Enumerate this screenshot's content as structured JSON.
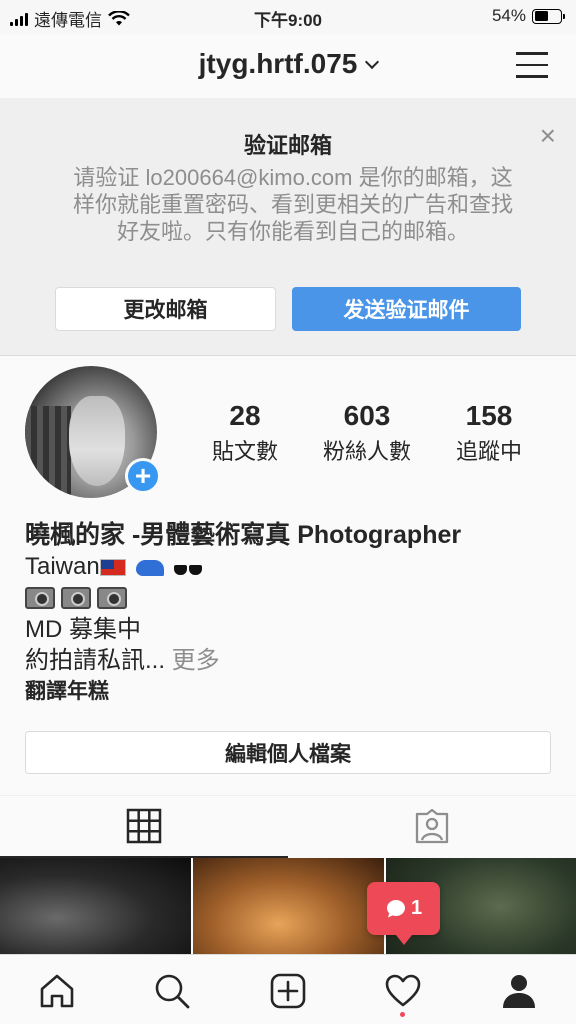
{
  "status_bar": {
    "carrier": "遠傳電信",
    "time": "下午9:00",
    "battery": "54%",
    "battery_level": 0.54
  },
  "header": {
    "username": "jtyg.hrtf.075",
    "icons": [
      "chevron-down-icon",
      "hamburger-menu-icon"
    ]
  },
  "verify_email": {
    "title": "验证邮箱",
    "body": "请验证 lo200664@kimo.com 是你的邮箱，这样你就能重置密码、看到更相关的广告和查找好友啦。只有你能看到自己的邮箱。",
    "change_button": "更改邮箱",
    "send_button": "发送验证邮件",
    "close_icon": "×"
  },
  "profile": {
    "stats": [
      {
        "value": "28",
        "label": "貼文數"
      },
      {
        "value": "603",
        "label": "粉絲人數"
      },
      {
        "value": "158",
        "label": "追蹤中"
      }
    ],
    "bio": {
      "name": "曉楓的家 -男體藝術寫真 Photographer",
      "line2": "Taiwan",
      "line4": "MD 募集中",
      "line5": "約拍請私訊...",
      "more": " 更多",
      "translate": "翻譯年糕"
    },
    "edit_button": "編輯個人檔案"
  },
  "tabs": [
    {
      "name": "grid",
      "icon": "grid-icon",
      "active": true
    },
    {
      "name": "tagged",
      "icon": "tagged-person-icon",
      "active": false
    }
  ],
  "notification": {
    "count": "1",
    "icon": "comment-icon"
  },
  "bottom_nav": [
    {
      "name": "home",
      "icon": "home-icon"
    },
    {
      "name": "search",
      "icon": "search-icon"
    },
    {
      "name": "new-post",
      "icon": "plus-square-icon"
    },
    {
      "name": "activity",
      "icon": "heart-icon"
    },
    {
      "name": "profile",
      "icon": "profile-icon"
    }
  ],
  "colors": {
    "accent": "#3897f0",
    "send_button": "#4a95e8",
    "notification": "#ed4956"
  }
}
